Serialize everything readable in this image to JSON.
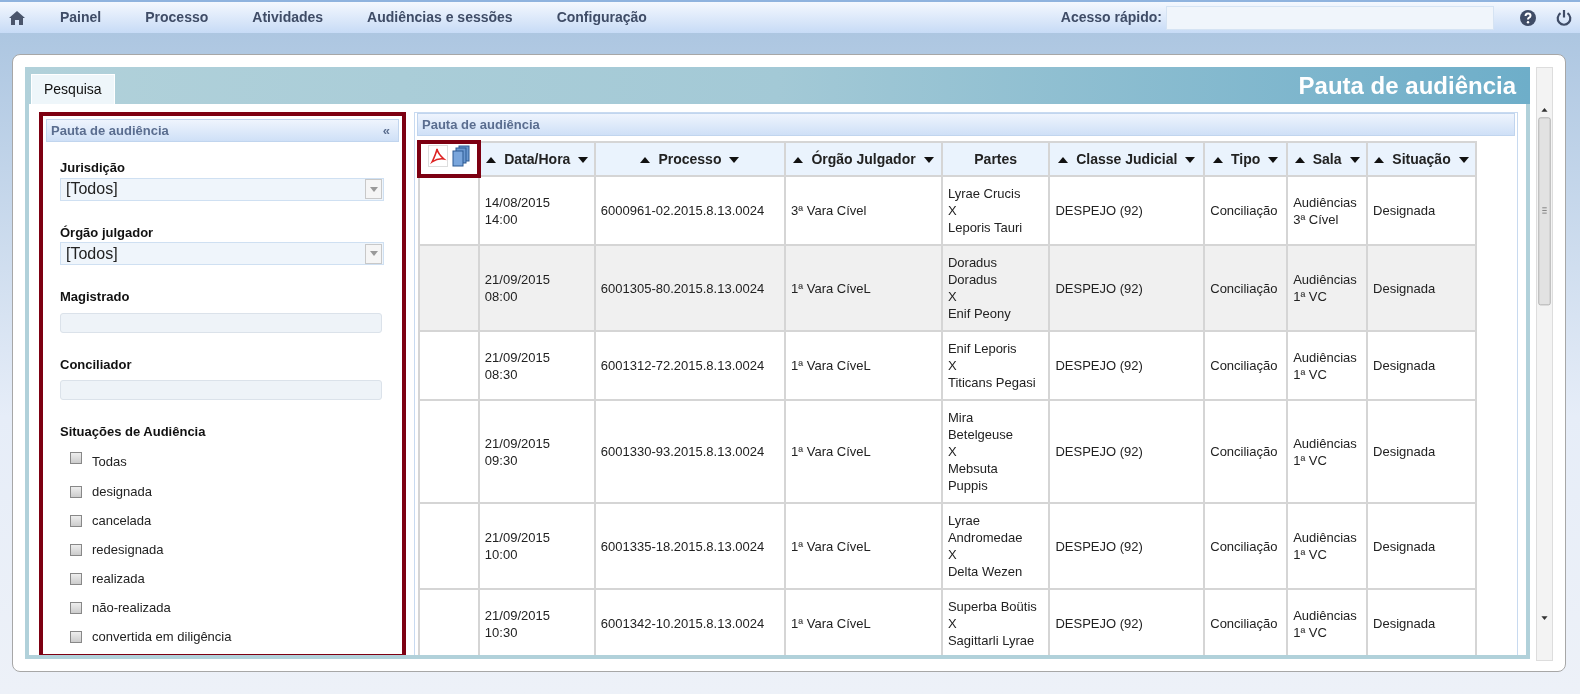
{
  "menu": [
    {
      "label": "Painel"
    },
    {
      "label": "Processo"
    },
    {
      "label": "Atividades"
    },
    {
      "label": "Audiências e sessões"
    },
    {
      "label": "Configuração"
    }
  ],
  "quick_access": {
    "label": "Acesso rápido:"
  },
  "page_title": "Pauta de audiência",
  "tabs": [
    {
      "label": "Pesquisa",
      "selected": true
    }
  ],
  "filter_panel": {
    "title": "Pauta de audiência",
    "collapse": "«",
    "fields": [
      {
        "kind": "select",
        "label": "Jurisdição",
        "value": "[Todos]"
      },
      {
        "kind": "select",
        "label": "Órgão julgador",
        "value": "[Todos]"
      },
      {
        "kind": "text",
        "label": "Magistrado"
      },
      {
        "kind": "text",
        "label": "Conciliador"
      }
    ],
    "status_title": "Situações de Audiência",
    "statuses": [
      {
        "label": "Todas",
        "checked": false
      },
      {
        "label": "designada",
        "checked": false
      },
      {
        "label": "cancelada",
        "checked": false
      },
      {
        "label": "redesignada",
        "checked": false
      },
      {
        "label": "realizada",
        "checked": false
      },
      {
        "label": "não-realizada",
        "checked": false
      },
      {
        "label": "convertida em diligência",
        "checked": false
      }
    ]
  },
  "results": {
    "title": "Pauta de audiência",
    "columns": [
      {
        "label": "Data/Hora",
        "sortable": true
      },
      {
        "label": "Processo",
        "sortable": true
      },
      {
        "label": "Órgão Julgador",
        "sortable": true
      },
      {
        "label": "Partes",
        "sortable": false
      },
      {
        "label": "Classe Judicial",
        "sortable": true
      },
      {
        "label": "Tipo",
        "sortable": true
      },
      {
        "label": "Sala",
        "sortable": true
      },
      {
        "label": "Situação",
        "sortable": true
      }
    ],
    "rows": [
      {
        "selected": false,
        "date": "14/08/2015",
        "time": "14:00",
        "process": "6000961-02.2015.8.13.0024",
        "court": "3ª Vara Cível",
        "parties": [
          "Lyrae Crucis",
          "X",
          "Leporis Tauri"
        ],
        "class": "DESPEJO (92)",
        "type": "Conciliação",
        "room": [
          "Audiências",
          "3ª Cível"
        ],
        "status": "Designada"
      },
      {
        "selected": true,
        "date": "21/09/2015",
        "time": "08:00",
        "process": "6001305-80.2015.8.13.0024",
        "court": "1ª Vara CíveL",
        "parties": [
          "Doradus",
          "Doradus",
          "X",
          "Enif Peony"
        ],
        "class": "DESPEJO (92)",
        "type": "Conciliação",
        "room": [
          "Audiências",
          "1ª VC"
        ],
        "status": "Designada"
      },
      {
        "selected": false,
        "date": "21/09/2015",
        "time": "08:30",
        "process": "6001312-72.2015.8.13.0024",
        "court": "1ª Vara CíveL",
        "parties": [
          "Enif Leporis",
          "X",
          "Titicans Pegasi"
        ],
        "class": "DESPEJO (92)",
        "type": "Conciliação",
        "room": [
          "Audiências",
          "1ª VC"
        ],
        "status": "Designada"
      },
      {
        "selected": false,
        "date": "21/09/2015",
        "time": "09:30",
        "process": "6001330-93.2015.8.13.0024",
        "court": "1ª Vara CíveL",
        "parties": [
          "Mira",
          "Betelgeuse",
          "X",
          "Mebsuta",
          "Puppis"
        ],
        "class": "DESPEJO (92)",
        "type": "Conciliação",
        "room": [
          "Audiências",
          "1ª VC"
        ],
        "status": "Designada"
      },
      {
        "selected": false,
        "date": "21/09/2015",
        "time": "10:00",
        "process": "6001335-18.2015.8.13.0024",
        "court": "1ª Vara CíveL",
        "parties": [
          "Lyrae",
          "Andromedae",
          "X",
          "Delta Wezen"
        ],
        "class": "DESPEJO (92)",
        "type": "Conciliação",
        "room": [
          "Audiências",
          "1ª VC"
        ],
        "status": "Designada"
      },
      {
        "selected": false,
        "date": "21/09/2015",
        "time": "10:30",
        "process": "6001342-10.2015.8.13.0024",
        "court": "1ª Vara CíveL",
        "parties": [
          "Superba Boütis",
          "X",
          "Sagittarli Lyrae"
        ],
        "class": "DESPEJO (92)",
        "type": "Conciliação",
        "room": [
          "Audiências",
          "1ª VC"
        ],
        "status": "Designada"
      }
    ]
  }
}
